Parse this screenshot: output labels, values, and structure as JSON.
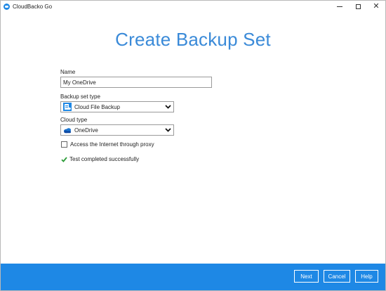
{
  "window": {
    "title": "CloudBacko Go",
    "accent_color": "#1e88e5",
    "title_color": "#3a8ad8"
  },
  "header": {
    "title": "Create Backup Set"
  },
  "form": {
    "name_label": "Name",
    "name_value": "My OneDrive",
    "backup_type_label": "Backup set type",
    "backup_type_value": "Cloud File Backup",
    "backup_type_icon": "cloud-file-backup-icon",
    "cloud_type_label": "Cloud type",
    "cloud_type_value": "OneDrive",
    "cloud_type_icon": "onedrive-cloud-icon",
    "proxy_label": "Access the Internet through proxy",
    "proxy_checked": false,
    "status_text": "Test completed successfully",
    "status_color": "#2e9d3a"
  },
  "footer": {
    "next_label": "Next",
    "cancel_label": "Cancel",
    "help_label": "Help"
  }
}
